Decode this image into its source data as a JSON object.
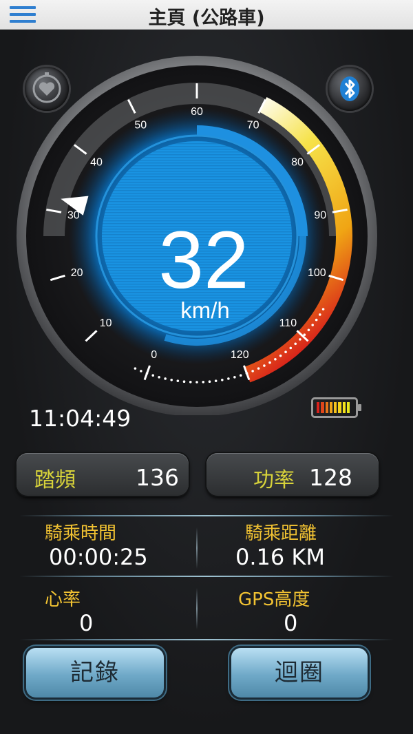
{
  "header": {
    "title": "主頁 (公路車)",
    "menu_icon": "hamburger-menu-icon"
  },
  "gauge": {
    "speed": "32",
    "unit": "km/h",
    "speed_value": 32,
    "ticks": [
      "0",
      "10",
      "20",
      "30",
      "40",
      "50",
      "60",
      "70",
      "80",
      "90",
      "100",
      "110",
      "120"
    ],
    "scale_max": 120,
    "colors": {
      "blue": "#1e90e0",
      "yellow": "#f4c21c",
      "red": "#d8211b"
    }
  },
  "icons": {
    "left": "heart-rate-timer-icon",
    "right": "bluetooth-icon"
  },
  "status": {
    "time": "11:04:49",
    "battery": "battery-icon"
  },
  "metrics": {
    "cadence": {
      "label": "踏頻",
      "value": "136"
    },
    "power": {
      "label": "功率",
      "value": "128"
    }
  },
  "stats": {
    "ride_time": {
      "label": "騎乘時間",
      "value": "00:00:25"
    },
    "distance": {
      "label": "騎乘距離",
      "value": "0.16 KM"
    },
    "heart_rate": {
      "label": "心率",
      "value": "0"
    },
    "gps_altitude": {
      "label": "GPS高度",
      "value": "0"
    }
  },
  "buttons": {
    "record": "記錄",
    "lap": "迴圈"
  }
}
